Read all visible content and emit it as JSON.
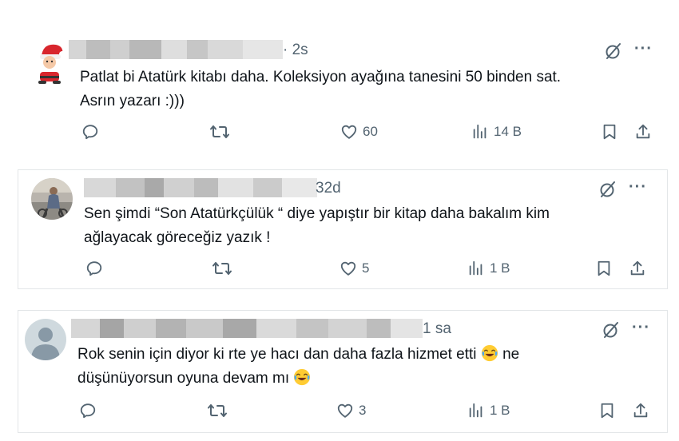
{
  "posts": [
    {
      "time": "· 2s",
      "text_lines": [
        "Patlat bi Atatürk kitabı daha. Koleksiyon ayağına tanesini 50 binden sat.",
        "Asrın yazarı :)))"
      ],
      "replies": "",
      "retweets": "",
      "likes": "60",
      "views": "14 B",
      "avatar": "santa-emoji"
    },
    {
      "time": "32d",
      "text_lines": [
        "Sen şimdi “Son Atatürkçülük “ diye yapıştır bir kitap daha bakalım kim",
        "ağlayacak göreceğiz yazık !"
      ],
      "replies": "",
      "retweets": "",
      "likes": "5",
      "views": "1 B",
      "avatar": "photo"
    },
    {
      "time": "1 sa",
      "text_line1": "Rok senin için diyor ki rte ye hacı dan daha fazla hizmet etti",
      "text_line1_end": "ne",
      "text_line2": "düşünüyorsun oyuna devam mı",
      "replies": "",
      "retweets": "",
      "likes": "3",
      "views": "1 B",
      "avatar": "default-profile"
    }
  ],
  "icons": {
    "more": "···",
    "reply": "reply-icon",
    "retweet": "retweet-icon",
    "like": "heart-icon",
    "views": "views-icon",
    "bookmark": "bookmark-icon",
    "share": "share-icon",
    "grok": "grok-icon",
    "emoji": "face-with-tears-of-joy"
  },
  "colors": {
    "text": "#0f1419",
    "muted": "#536471",
    "border": "#e3e6e8"
  }
}
